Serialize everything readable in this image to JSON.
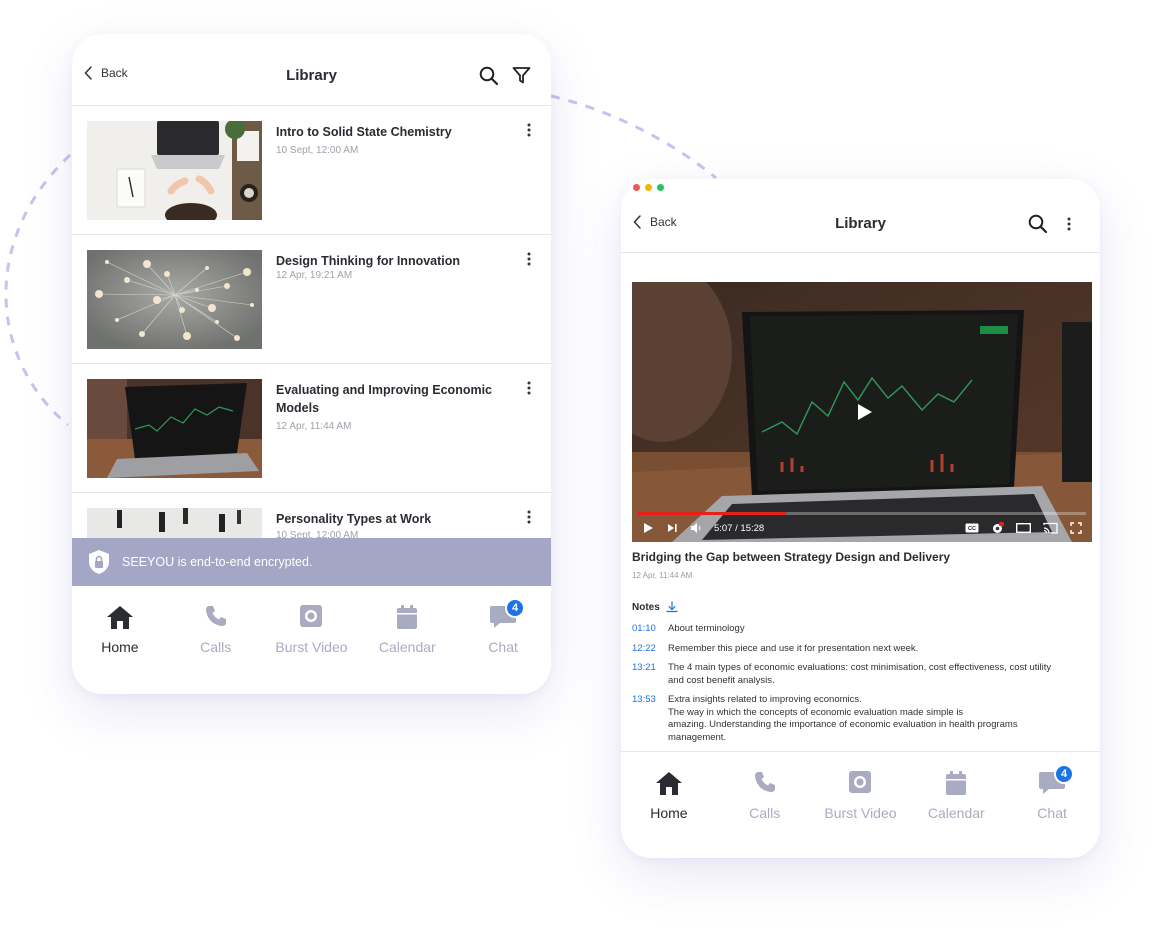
{
  "colors": {
    "accent": "#1a73e8",
    "banner": "#a3a6c4",
    "nav_inactive": "#a9abc2",
    "dashed_line": "#c8c2f0",
    "text": "#2b2b33"
  },
  "left": {
    "header": {
      "back_label": "Back",
      "title": "Library",
      "icons": [
        "search-icon",
        "filter-icon"
      ]
    },
    "items": [
      {
        "title": "Intro to Solid State Chemistry",
        "date": "10 Sept, 12:00 AM"
      },
      {
        "title": "Design Thinking for Innovation",
        "date": "12 Apr, 19:21 AM"
      },
      {
        "title": "Evaluating and Improving Economic Models",
        "date": "12 Apr, 11:44 AM"
      },
      {
        "title": "Personality Types at Work",
        "date": "10 Sept, 12:00 AM"
      }
    ],
    "banner": {
      "text": "SEEYOU is end-to-end encrypted."
    }
  },
  "right": {
    "header": {
      "back_label": "Back",
      "title": "Library",
      "icons": [
        "search-icon",
        "more-icon"
      ]
    },
    "video": {
      "time": "5:07 / 15:28",
      "progress": 0.33
    },
    "title": "Bridging the Gap between Strategy Design and Delivery",
    "date": "12 Apr, 11:44 AM",
    "notes_label": "Notes",
    "notes": [
      {
        "time": "01:10",
        "text": "About terminology"
      },
      {
        "time": "12:22",
        "text": "Remember this piece and use it for presentation next week."
      },
      {
        "time": "13:21",
        "text": "The 4 main types of economic evaluations: cost minimisation, cost effectiveness, cost utility\nand cost benefit analysis."
      },
      {
        "time": "13:53",
        "text": "Extra insights related to improving economics.\nThe way in which the concepts of economic evaluation made simple is\namazing. Understanding the importance of economic evaluation in health programs\nmanagement."
      }
    ]
  },
  "nav": {
    "items": [
      {
        "label": "Home",
        "icon": "home-icon",
        "active": true
      },
      {
        "label": "Calls",
        "icon": "phone-icon",
        "active": false
      },
      {
        "label": "Burst Video",
        "icon": "video-icon",
        "active": false
      },
      {
        "label": "Calendar",
        "icon": "calendar-icon",
        "active": false
      },
      {
        "label": "Chat",
        "icon": "chat-icon",
        "active": false,
        "badge": "4"
      }
    ]
  }
}
